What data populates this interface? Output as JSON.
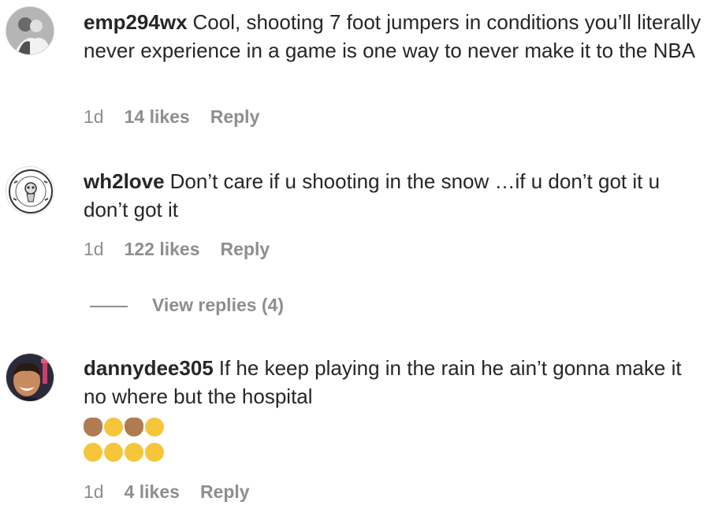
{
  "comments": [
    {
      "username": "emp294wx",
      "text": "Cool, shooting 7 foot jumpers in conditions you’ll literally never experience in a game is one way to never make it to the NBA",
      "time": "1d",
      "likes": "14 likes",
      "reply": "Reply"
    },
    {
      "username": "wh2love",
      "text": "Don’t care if u shooting in the snow …if u don’t got it u don’t got it",
      "time": "1d",
      "likes": "122 likes",
      "reply": "Reply",
      "view_replies": "View replies (4)"
    },
    {
      "username": "dannydee305",
      "text": "If he keep playing in the rain he ain’t gonna make it no where but the hospital",
      "emoji_line_1": [
        "facepalm-emoji",
        "woozy-face-emoji",
        "shrug-emoji",
        "upside-down-face-emoji"
      ],
      "emoji_line_2": [
        "rofl-emoji",
        "rofl-emoji",
        "joy-emoji",
        "rofl-emoji"
      ],
      "time": "1d",
      "likes": "4 likes",
      "reply": "Reply"
    }
  ],
  "colors": {
    "text": "#262626",
    "meta": "#8e8e8e",
    "background": "#ffffff"
  }
}
